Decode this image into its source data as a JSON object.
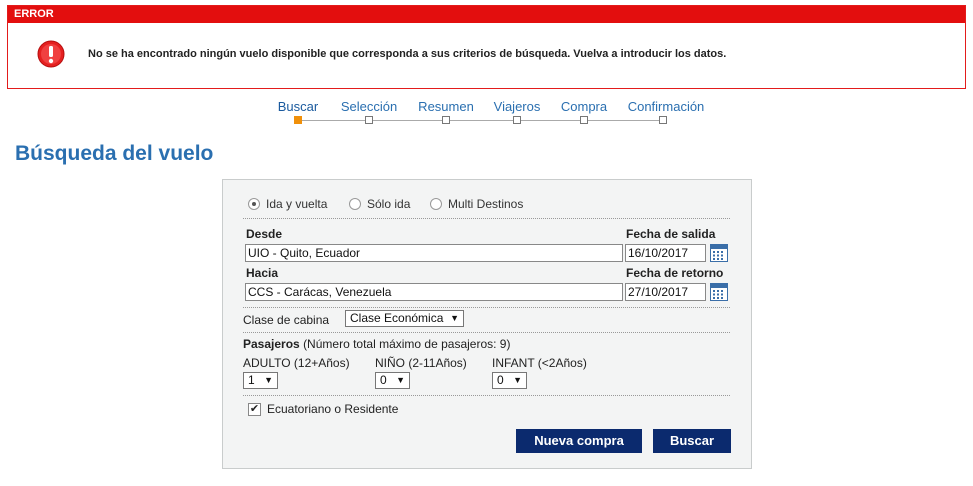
{
  "error": {
    "title": "ERROR",
    "icon": "exclamation-circle-icon",
    "message": "No se ha encontrado ningún vuelo disponible que corresponda a sus criterios de búsqueda. Vuelva a introducir los datos."
  },
  "steps": {
    "items": [
      {
        "label": "Buscar",
        "active": true
      },
      {
        "label": "Selección",
        "active": false
      },
      {
        "label": "Resumen",
        "active": false
      },
      {
        "label": "Viajeros",
        "active": false
      },
      {
        "label": "Compra",
        "active": false
      },
      {
        "label": "Confirmación",
        "active": false
      }
    ]
  },
  "page_title": "Búsqueda del vuelo",
  "trip_type": {
    "options": [
      "Ida y vuelta",
      "Sólo ida",
      "Multi Destinos"
    ],
    "selected": "Ida y vuelta"
  },
  "from": {
    "label": "Desde",
    "value": "UIO - Quito, Ecuador"
  },
  "to": {
    "label": "Hacia",
    "value": "CCS - Carácas, Venezuela"
  },
  "departure": {
    "label": "Fecha de salida",
    "value": "16/10/2017",
    "icon": "calendar-icon"
  },
  "return": {
    "label": "Fecha de retorno",
    "value": "27/10/2017",
    "icon": "calendar-icon"
  },
  "cabin": {
    "label": "Clase de cabina",
    "value": "Clase Económica"
  },
  "passengers": {
    "title": "Pasajeros",
    "note": "(Número total máximo de pasajeros: 9)",
    "adult": {
      "label": "ADULTO (12+Años)",
      "value": "1"
    },
    "child": {
      "label": "NIÑO (2-11Años)",
      "value": "0"
    },
    "infant": {
      "label": "INFANT (<2Años)",
      "value": "0"
    }
  },
  "resident": {
    "label": "Ecuatoriano o Residente",
    "checked": true
  },
  "buttons": {
    "new_purchase": "Nueva compra",
    "search": "Buscar"
  },
  "colors": {
    "error_red": "#e30e0e",
    "link_blue": "#2a6fb0",
    "button_navy": "#0b2a6e",
    "step_active": "#f0900a"
  }
}
